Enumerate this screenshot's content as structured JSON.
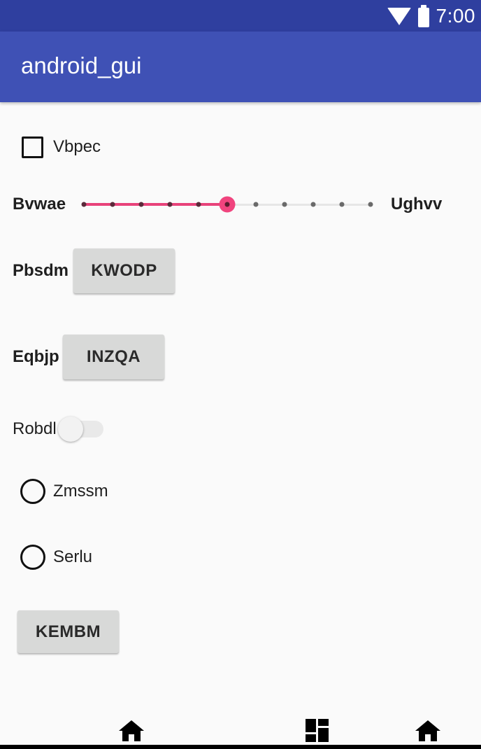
{
  "status_bar": {
    "time": "7:00",
    "icons": [
      "wifi-icon",
      "battery-icon"
    ],
    "background": "#2f3f9f"
  },
  "app_bar": {
    "title": "android_gui",
    "background": "#3f51b5"
  },
  "checkbox": {
    "label": "Vbpec",
    "checked": false
  },
  "slider": {
    "label_left": "Bvwae",
    "label_right": "Ughvv",
    "ticks": 11,
    "value_index": 5,
    "accent": "#f0447e"
  },
  "row_pbsdm": {
    "label": "Pbsdm",
    "button": "KWODP"
  },
  "row_eqbjp": {
    "label": "Eqbjp",
    "button": "INZQA"
  },
  "switch": {
    "label": "Robdl",
    "on": false
  },
  "radios": [
    {
      "label": "Zmssm",
      "selected": false
    },
    {
      "label": "Serlu",
      "selected": false
    }
  ],
  "bottom_button": {
    "label": "KEMBM"
  },
  "nav_bar": {
    "icons": [
      "home-icon",
      "dashboard-icon",
      "home-icon"
    ]
  }
}
